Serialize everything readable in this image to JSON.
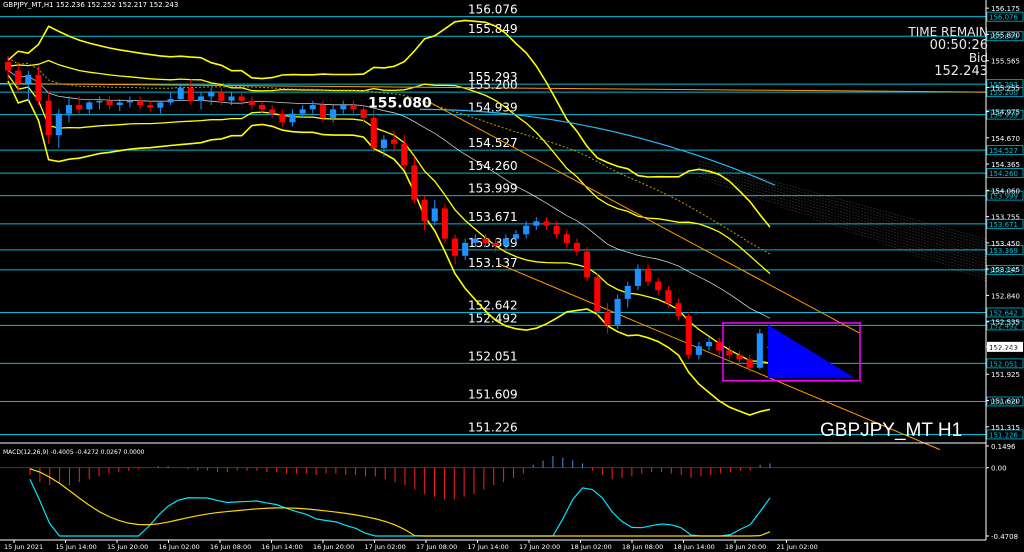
{
  "header": {
    "text": "GBPJPY_MT,H1  152.236 152.252 152.217 152.243"
  },
  "info_box": {
    "line1": "TIME REMAIN",
    "line2": "00:50:26",
    "line3": "Bid",
    "line4": "152.243"
  },
  "symbol_label": "GBPJPY_MT H1",
  "macd_label": "MACD(12,26,9) -0.4005 -0.4272 0.0267 0.0000",
  "colors": {
    "background": "#000000",
    "bull": "#1e90ff",
    "bear": "#ff0000",
    "level_line": "#00bcd4",
    "band": "#ffff00",
    "bid_tag": "#ffffff",
    "triangle": "#0000ff",
    "box": "#ff00ff",
    "trend": "#ff9900",
    "macd_line": "#00e5ff",
    "signal_line": "#ffd700"
  },
  "chart_data": {
    "type": "candlestick",
    "ylim": [
      151.15,
      156.2
    ],
    "levels": [
      {
        "value": 156.076,
        "label": "156.076"
      },
      {
        "value": 155.849,
        "label": "155.849"
      },
      {
        "value": 155.293,
        "label": "155.293"
      },
      {
        "value": 155.2,
        "label": "155.200"
      },
      {
        "value": 154.939,
        "label": "154.939"
      },
      {
        "value": 154.527,
        "label": "154.527"
      },
      {
        "value": 154.26,
        "label": "154.260"
      },
      {
        "value": 153.999,
        "label": "153.999"
      },
      {
        "value": 153.671,
        "label": "153.671"
      },
      {
        "value": 153.369,
        "label": "153.369"
      },
      {
        "value": 153.137,
        "label": "153.137"
      },
      {
        "value": 152.642,
        "label": "152.642"
      },
      {
        "value": 152.492,
        "label": "152.492"
      },
      {
        "value": 152.051,
        "label": "152.051"
      },
      {
        "value": 151.609,
        "label": "151.609"
      },
      {
        "value": 151.226,
        "label": "151.226"
      }
    ],
    "price_axis_ticks": [
      "156.175",
      "155.870",
      "155.565",
      "155.255",
      "154.975",
      "154.670",
      "154.365",
      "154.060",
      "153.755",
      "153.450",
      "153.145",
      "152.840",
      "152.535",
      "152.243",
      "151.925",
      "151.620",
      "151.315"
    ],
    "time_ticks": [
      "15 Jun 2021",
      "15 Jun 14:00",
      "15 Jun 20:00",
      "16 Jun 02:00",
      "16 Jun 08:00",
      "16 Jun 14:00",
      "16 Jun 20:00",
      "17 Jun 02:00",
      "17 Jun 08:00",
      "17 Jun 14:00",
      "17 Jun 20:00",
      "18 Jun 02:00",
      "18 Jun 08:00",
      "18 Jun 14:00",
      "18 Jun 20:00",
      "21 Jun 02:00"
    ],
    "annotation": {
      "text": "155.080",
      "value": 155.08
    },
    "current_bid": 152.243,
    "candles": [
      {
        "o": 155.55,
        "h": 155.62,
        "l": 155.35,
        "c": 155.45
      },
      {
        "o": 155.45,
        "h": 155.55,
        "l": 155.2,
        "c": 155.3
      },
      {
        "o": 155.3,
        "h": 155.45,
        "l": 155.1,
        "c": 155.4
      },
      {
        "o": 155.4,
        "h": 155.5,
        "l": 155.05,
        "c": 155.1
      },
      {
        "o": 155.1,
        "h": 155.2,
        "l": 154.6,
        "c": 154.7
      },
      {
        "o": 154.7,
        "h": 155.0,
        "l": 154.55,
        "c": 154.95
      },
      {
        "o": 154.95,
        "h": 155.15,
        "l": 154.85,
        "c": 155.05
      },
      {
        "o": 155.05,
        "h": 155.15,
        "l": 154.95,
        "c": 155.0
      },
      {
        "o": 155.0,
        "h": 155.1,
        "l": 154.95,
        "c": 155.08
      },
      {
        "o": 155.08,
        "h": 155.15,
        "l": 155.0,
        "c": 155.1
      },
      {
        "o": 155.1,
        "h": 155.15,
        "l": 155.0,
        "c": 155.05
      },
      {
        "o": 155.05,
        "h": 155.12,
        "l": 154.98,
        "c": 155.08
      },
      {
        "o": 155.08,
        "h": 155.15,
        "l": 155.02,
        "c": 155.1
      },
      {
        "o": 155.1,
        "h": 155.15,
        "l": 155.0,
        "c": 155.05
      },
      {
        "o": 155.05,
        "h": 155.1,
        "l": 154.98,
        "c": 155.02
      },
      {
        "o": 155.02,
        "h": 155.1,
        "l": 154.95,
        "c": 155.08
      },
      {
        "o": 155.08,
        "h": 155.2,
        "l": 155.05,
        "c": 155.12
      },
      {
        "o": 155.12,
        "h": 155.3,
        "l": 155.1,
        "c": 155.25
      },
      {
        "o": 155.25,
        "h": 155.35,
        "l": 155.05,
        "c": 155.1
      },
      {
        "o": 155.1,
        "h": 155.2,
        "l": 155.0,
        "c": 155.15
      },
      {
        "o": 155.15,
        "h": 155.25,
        "l": 155.05,
        "c": 155.2
      },
      {
        "o": 155.2,
        "h": 155.25,
        "l": 155.05,
        "c": 155.1
      },
      {
        "o": 155.1,
        "h": 155.2,
        "l": 155.05,
        "c": 155.15
      },
      {
        "o": 155.15,
        "h": 155.2,
        "l": 155.05,
        "c": 155.1
      },
      {
        "o": 155.1,
        "h": 155.15,
        "l": 155.0,
        "c": 155.05
      },
      {
        "o": 155.05,
        "h": 155.1,
        "l": 154.95,
        "c": 155.0
      },
      {
        "o": 155.0,
        "h": 155.05,
        "l": 154.9,
        "c": 154.95
      },
      {
        "o": 154.95,
        "h": 155.0,
        "l": 154.8,
        "c": 154.85
      },
      {
        "o": 154.85,
        "h": 155.0,
        "l": 154.8,
        "c": 154.95
      },
      {
        "o": 154.95,
        "h": 155.05,
        "l": 154.9,
        "c": 155.0
      },
      {
        "o": 155.0,
        "h": 155.1,
        "l": 154.95,
        "c": 155.05
      },
      {
        "o": 155.05,
        "h": 155.1,
        "l": 154.85,
        "c": 154.9
      },
      {
        "o": 154.9,
        "h": 155.05,
        "l": 154.85,
        "c": 155.0
      },
      {
        "o": 155.0,
        "h": 155.1,
        "l": 154.95,
        "c": 155.05
      },
      {
        "o": 155.05,
        "h": 155.1,
        "l": 154.95,
        "c": 155.0
      },
      {
        "o": 155.0,
        "h": 155.05,
        "l": 154.85,
        "c": 154.9
      },
      {
        "o": 154.9,
        "h": 155.0,
        "l": 154.5,
        "c": 154.55
      },
      {
        "o": 154.55,
        "h": 154.7,
        "l": 154.45,
        "c": 154.65
      },
      {
        "o": 154.65,
        "h": 154.75,
        "l": 154.5,
        "c": 154.6
      },
      {
        "o": 154.6,
        "h": 154.7,
        "l": 154.3,
        "c": 154.35
      },
      {
        "o": 154.35,
        "h": 154.45,
        "l": 153.9,
        "c": 153.95
      },
      {
        "o": 153.95,
        "h": 154.0,
        "l": 153.6,
        "c": 153.7
      },
      {
        "o": 153.7,
        "h": 153.95,
        "l": 153.65,
        "c": 153.85
      },
      {
        "o": 153.85,
        "h": 153.9,
        "l": 153.45,
        "c": 153.5
      },
      {
        "o": 153.5,
        "h": 153.55,
        "l": 153.2,
        "c": 153.3
      },
      {
        "o": 153.3,
        "h": 153.5,
        "l": 153.25,
        "c": 153.45
      },
      {
        "o": 153.45,
        "h": 153.55,
        "l": 153.4,
        "c": 153.5
      },
      {
        "o": 153.5,
        "h": 153.55,
        "l": 153.4,
        "c": 153.45
      },
      {
        "o": 153.45,
        "h": 153.5,
        "l": 153.35,
        "c": 153.42
      },
      {
        "o": 153.42,
        "h": 153.55,
        "l": 153.38,
        "c": 153.5
      },
      {
        "o": 153.5,
        "h": 153.6,
        "l": 153.45,
        "c": 153.55
      },
      {
        "o": 153.55,
        "h": 153.7,
        "l": 153.5,
        "c": 153.65
      },
      {
        "o": 153.65,
        "h": 153.75,
        "l": 153.6,
        "c": 153.7
      },
      {
        "o": 153.7,
        "h": 153.75,
        "l": 153.6,
        "c": 153.65
      },
      {
        "o": 153.65,
        "h": 153.7,
        "l": 153.5,
        "c": 153.55
      },
      {
        "o": 153.55,
        "h": 153.6,
        "l": 153.4,
        "c": 153.45
      },
      {
        "o": 153.45,
        "h": 153.5,
        "l": 153.3,
        "c": 153.35
      },
      {
        "o": 153.35,
        "h": 153.4,
        "l": 153.0,
        "c": 153.05
      },
      {
        "o": 153.05,
        "h": 153.1,
        "l": 152.6,
        "c": 152.65
      },
      {
        "o": 152.65,
        "h": 152.75,
        "l": 152.4,
        "c": 152.5
      },
      {
        "o": 152.5,
        "h": 152.85,
        "l": 152.45,
        "c": 152.8
      },
      {
        "o": 152.8,
        "h": 153.0,
        "l": 152.7,
        "c": 152.95
      },
      {
        "o": 152.95,
        "h": 153.2,
        "l": 152.9,
        "c": 153.15
      },
      {
        "o": 153.15,
        "h": 153.2,
        "l": 152.95,
        "c": 153.0
      },
      {
        "o": 153.0,
        "h": 153.05,
        "l": 152.85,
        "c": 152.9
      },
      {
        "o": 152.9,
        "h": 152.95,
        "l": 152.7,
        "c": 152.75
      },
      {
        "o": 152.75,
        "h": 152.8,
        "l": 152.55,
        "c": 152.6
      },
      {
        "o": 152.6,
        "h": 152.65,
        "l": 152.1,
        "c": 152.15
      },
      {
        "o": 152.15,
        "h": 152.3,
        "l": 152.1,
        "c": 152.25
      },
      {
        "o": 152.25,
        "h": 152.35,
        "l": 152.2,
        "c": 152.3
      },
      {
        "o": 152.3,
        "h": 152.35,
        "l": 152.15,
        "c": 152.2
      },
      {
        "o": 152.2,
        "h": 152.25,
        "l": 152.1,
        "c": 152.15
      },
      {
        "o": 152.15,
        "h": 152.2,
        "l": 152.05,
        "c": 152.1
      },
      {
        "o": 152.1,
        "h": 152.15,
        "l": 151.95,
        "c": 152.0
      },
      {
        "o": 152.0,
        "h": 152.45,
        "l": 151.98,
        "c": 152.4
      },
      {
        "o": 152.236,
        "h": 152.252,
        "l": 152.217,
        "c": 152.243
      }
    ],
    "macd_hist": [
      -0.05,
      -0.1,
      -0.12,
      -0.1,
      -0.12,
      -0.1,
      -0.08,
      -0.06,
      -0.04,
      -0.03,
      -0.02,
      -0.01,
      0.0,
      0.01,
      0.01,
      0.0,
      -0.01,
      -0.02,
      -0.02,
      -0.03,
      -0.03,
      -0.02,
      -0.02,
      -0.02,
      -0.03,
      -0.03,
      -0.04,
      -0.04,
      -0.04,
      -0.05,
      -0.04,
      -0.04,
      -0.05,
      -0.05,
      -0.06,
      -0.06,
      -0.08,
      -0.1,
      -0.12,
      -0.15,
      -0.18,
      -0.2,
      -0.22,
      -0.22,
      -0.2,
      -0.18,
      -0.15,
      -0.12,
      -0.1,
      -0.07,
      -0.04,
      0.02,
      0.05,
      0.08,
      0.07,
      0.05,
      0.03,
      -0.02,
      -0.05,
      -0.08,
      -0.07,
      -0.06,
      -0.04,
      -0.03,
      -0.03,
      -0.04,
      -0.05,
      -0.07,
      -0.06,
      -0.05,
      -0.04,
      -0.03,
      -0.02,
      -0.02,
      0.02,
      0.03
    ],
    "macd_levels": [
      {
        "value": 0.1496,
        "label": "0.1496"
      },
      {
        "value": 0.0,
        "label": "0.00"
      },
      {
        "value": -0.4708,
        "label": "-0.4708"
      }
    ]
  }
}
